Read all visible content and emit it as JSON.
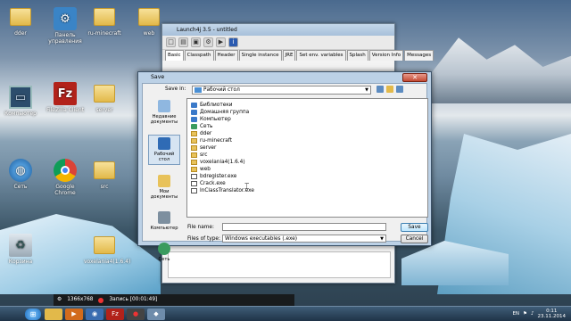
{
  "desktop": {
    "icons": [
      {
        "label": "dder",
        "glyph": "folder"
      },
      {
        "label": "Панель управления",
        "glyph": "control-panel"
      },
      {
        "label": "ru-minecraft",
        "glyph": "folder"
      },
      {
        "label": "web",
        "glyph": "folder"
      },
      {
        "label": "Компьютер",
        "glyph": "computer"
      },
      {
        "label": "FileZilla Client",
        "glyph": "filezilla"
      },
      {
        "label": "server",
        "glyph": "folder"
      },
      {
        "label": "Сеть",
        "glyph": "network"
      },
      {
        "label": "Google Chrome",
        "glyph": "chrome"
      },
      {
        "label": "src",
        "glyph": "folder"
      },
      {
        "label": "Корзина",
        "glyph": "recycle-bin"
      },
      {
        "label": "voxelania4(1.6.4)",
        "glyph": "folder"
      }
    ]
  },
  "launch4j": {
    "title": "Launch4j 3.5 - untitled",
    "tabs": [
      "Basic",
      "Classpath",
      "Header",
      "Single instance",
      "JRE",
      "Set env. variables",
      "Splash",
      "Version Info",
      "Messages"
    ]
  },
  "save_dialog": {
    "title": "Save",
    "save_in_label": "Save in:",
    "save_in_value": "Рабочий стол",
    "places": [
      {
        "label": "Недавние документы"
      },
      {
        "label": "Рабочий стол"
      },
      {
        "label": "Мои документы"
      },
      {
        "label": "Компьютер"
      },
      {
        "label": "Сеть"
      }
    ],
    "files": [
      {
        "name": "Библиотеки",
        "kind": "blue"
      },
      {
        "name": "Домашняя группа",
        "kind": "blue"
      },
      {
        "name": "Компьютер",
        "kind": "blue"
      },
      {
        "name": "Сеть",
        "kind": "green"
      },
      {
        "name": "dder",
        "kind": "folder"
      },
      {
        "name": "ru-minecraft",
        "kind": "folder"
      },
      {
        "name": "server",
        "kind": "folder"
      },
      {
        "name": "src",
        "kind": "folder"
      },
      {
        "name": "voxelania4(1.6.4)",
        "kind": "folder"
      },
      {
        "name": "web",
        "kind": "folder"
      },
      {
        "name": "bdregister.exe",
        "kind": "exe"
      },
      {
        "name": "Crack.exe",
        "kind": "exe"
      },
      {
        "name": "InClassTranslator.exe",
        "kind": "exe"
      }
    ],
    "file_name_label": "File name:",
    "file_name_value": "",
    "file_type_label": "Files of type:",
    "file_type_value": "Windows executables (.exe)",
    "save_button": "Save",
    "cancel_button": "Cancel"
  },
  "recorder": {
    "resolution": "1366x768",
    "status": "Запись [00:01:49]"
  },
  "taskbar": {
    "lang": "EN",
    "time": "0:11",
    "date": "23.11.2014"
  }
}
